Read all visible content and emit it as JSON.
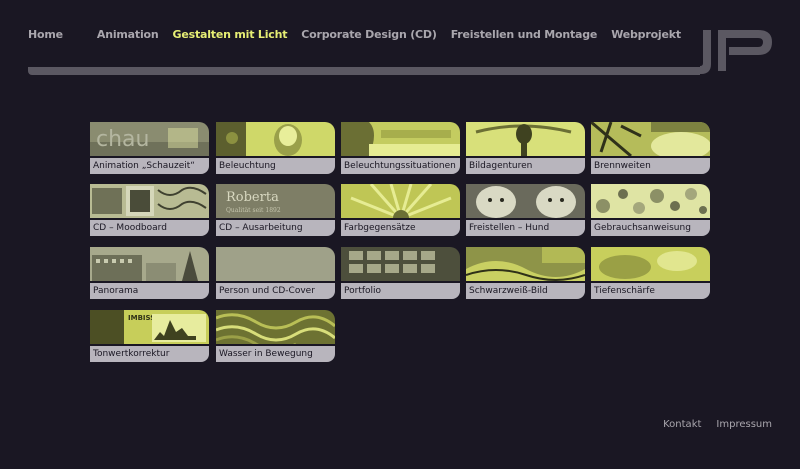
{
  "nav": {
    "items": [
      {
        "label": "Home",
        "active": false
      },
      {
        "label": "Animation",
        "active": false
      },
      {
        "label": "Gestalten mit Licht",
        "active": true
      },
      {
        "label": "Corporate Design (CD)",
        "active": false
      },
      {
        "label": "Freistellen und Montage",
        "active": false
      },
      {
        "label": "Webprojekt",
        "active": false
      }
    ]
  },
  "colors": {
    "background": "#1a1723",
    "accent": "#e6ee74",
    "muted": "#a9a6ad",
    "label_bg": "#b8b5bd"
  },
  "tiles": [
    {
      "label": "Animation „Schauzeit“",
      "thumb_text": "chau"
    },
    {
      "label": "Beleuchtung"
    },
    {
      "label": "Beleuchtungssituationen"
    },
    {
      "label": "Bildagenturen"
    },
    {
      "label": "Brennweiten"
    },
    {
      "label": "CD – Moodboard"
    },
    {
      "label": "CD – Ausarbeitung",
      "thumb_text": "Roberta",
      "thumb_subtext": "Qualität seit 1892"
    },
    {
      "label": "Farbgegensätze"
    },
    {
      "label": "Freistellen – Hund"
    },
    {
      "label": "Gebrauchsanweisung"
    },
    {
      "label": "Panorama"
    },
    {
      "label": "Person und CD-Cover"
    },
    {
      "label": "Portfolio"
    },
    {
      "label": "Schwarzweiß-Bild"
    },
    {
      "label": "Tiefenschärfe"
    },
    {
      "label": "Tonwertkorrektur",
      "thumb_text": "IMBISS"
    },
    {
      "label": "Wasser in Bewegung"
    }
  ],
  "footer": {
    "kontakt": "Kontakt",
    "impressum": "Impressum"
  }
}
